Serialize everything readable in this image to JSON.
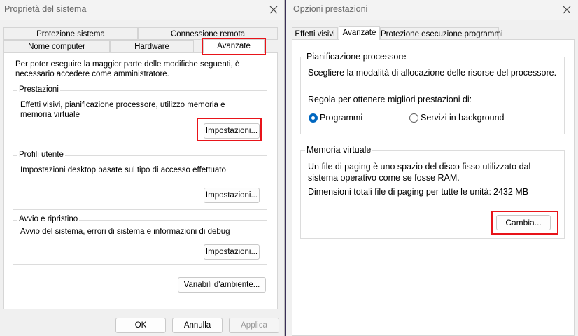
{
  "left_window": {
    "title": "Proprietà del sistema",
    "tabs_row1": [
      "Protezione sistema",
      "Connessione remota"
    ],
    "tabs_row2": [
      "Nome computer",
      "Hardware",
      "Avanzate"
    ],
    "intro": "Per poter eseguire la maggior parte delle modifiche seguenti, è necessario accedere come amministratore.",
    "performance": {
      "label": "Prestazioni",
      "description": "Effetti visivi, pianificazione processore, utilizzo memoria e memoria virtuale",
      "button": "Impostazioni..."
    },
    "profiles": {
      "label": "Profili utente",
      "description": "Impostazioni desktop basate sul tipo di accesso effettuato",
      "button": "Impostazioni..."
    },
    "startup": {
      "label": "Avvio e ripristino",
      "description": "Avvio del sistema, errori di sistema e informazioni di debug",
      "button": "Impostazioni..."
    },
    "env_button": "Variabili d'ambiente...",
    "ok": "OK",
    "cancel": "Annulla",
    "apply": "Applica"
  },
  "right_window": {
    "title": "Opzioni prestazioni",
    "tabs": [
      "Effetti visivi",
      "Avanzate",
      "Protezione esecuzione programmi"
    ],
    "scheduling": {
      "label": "Pianificazione processore",
      "description": "Scegliere la modalità di allocazione delle risorse del processore.",
      "adjust_label": "Regola per ottenere migliori prestazioni di:",
      "option_programs": "Programmi",
      "option_background": "Servizi in background",
      "selected": "Programmi"
    },
    "virtual_memory": {
      "label": "Memoria virtuale",
      "description": "Un file di paging è uno spazio del disco fisso utilizzato dal sistema operativo come se fosse RAM.",
      "total_label": "Dimensioni totali file di paging per tutte le unità:",
      "total_value": "2432 MB",
      "button": "Cambia..."
    }
  },
  "colors": {
    "highlight": "#e8141a",
    "radio_accent": "#0067c0",
    "background": "#3a2f57"
  },
  "icons": [
    "close-icon"
  ]
}
